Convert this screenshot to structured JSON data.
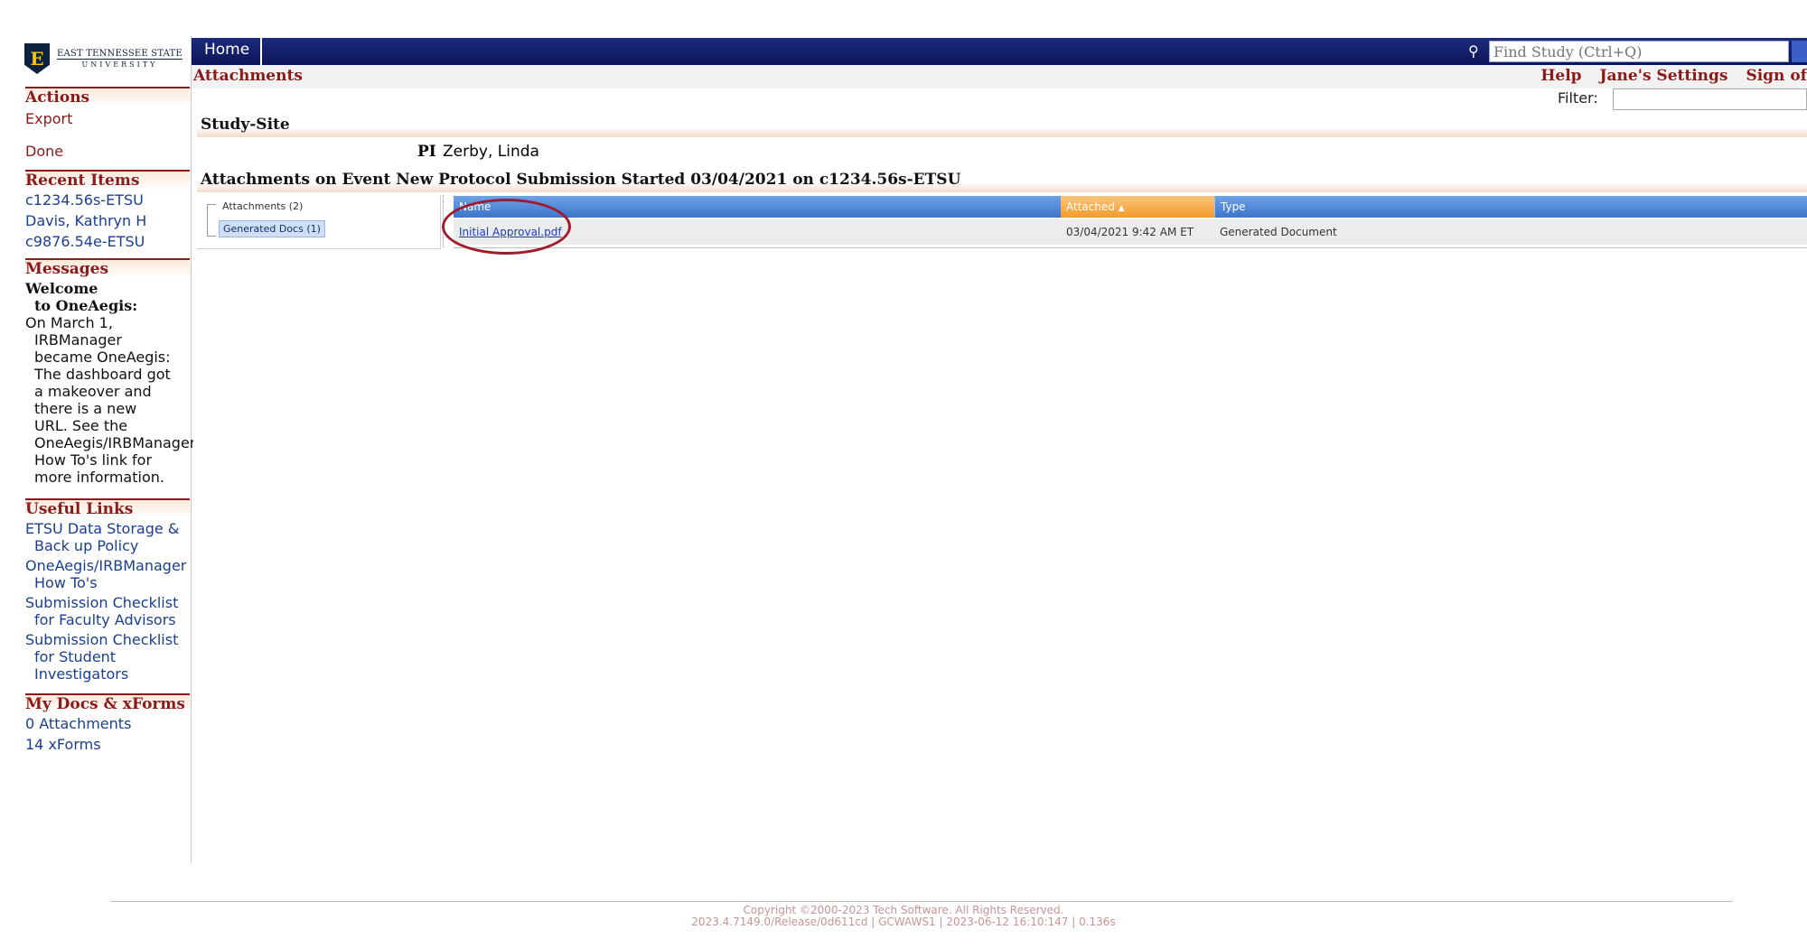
{
  "logo": {
    "letter": "E",
    "line1": "EAST TENNESSEE STATE",
    "line2": "UNIVERSITY"
  },
  "sidebar": {
    "actions": {
      "heading": "Actions",
      "items": [
        "Export",
        "Done"
      ]
    },
    "recent": {
      "heading": "Recent Items",
      "items": [
        "c1234.56s-ETSU",
        "Davis, Kathryn H",
        "c9876.54e-ETSU"
      ]
    },
    "messages": {
      "heading": "Messages",
      "title1": "Welcome",
      "title2": "to OneAegis:",
      "lines": [
        "On March 1,",
        "IRBManager",
        "became OneAegis:",
        " The dashboard got",
        "a makeover and",
        "there is a new",
        "URL.  See the",
        "OneAegis/IRBManager",
        "How To's link for",
        "more information."
      ]
    },
    "useful": {
      "heading": "Useful Links",
      "items": [
        {
          "line1": "ETSU Data Storage &",
          "line2": "Back up Policy"
        },
        {
          "line1": "OneAegis/IRBManager",
          "line2": "How To's"
        },
        {
          "line1": "Submission Checklist",
          "line2": "for Faculty Advisors"
        },
        {
          "line1": "Submission Checklist",
          "line2": "for Student",
          "line3": "Investigators"
        }
      ]
    },
    "mydocs": {
      "heading": "My Docs & xForms",
      "items": [
        "0 Attachments",
        "14 xForms"
      ]
    }
  },
  "topbar": {
    "home": "Home",
    "find_placeholder": "Find Study (Ctrl+Q)",
    "find_icon": "binoculars-icon"
  },
  "subheader": {
    "title": "Attachments",
    "links": [
      "Help",
      "Jane's Settings",
      "Sign of"
    ]
  },
  "filter": {
    "label": "Filter:"
  },
  "study_site": {
    "heading": "Study-Site",
    "pi_label": "PI",
    "pi_value": "Zerby, Linda"
  },
  "attachments_section": {
    "heading": "Attachments on Event New Protocol Submission Started 03/04/2021 on c1234.56s-ETSU"
  },
  "tree": {
    "root": "Attachments (2)",
    "child": "Generated Docs (1)"
  },
  "grid": {
    "columns": [
      "Name",
      "Attached",
      "Type"
    ],
    "sort_indicator": "▲",
    "rows": [
      {
        "name": "Initial Approval.pdf",
        "attached": "03/04/2021 9:42 AM ET",
        "type": "Generated Document"
      }
    ]
  },
  "footer": {
    "copyright": "Copyright ©2000-2023 Tech Software. All Rights Reserved.",
    "build": "2023.4.7149.0/Release/0d611cd | GCWAWS1 | 2023-06-12 16:10:147 | 0.136s"
  },
  "colors": {
    "nav": "#0c1559",
    "accent": "#8b1a1a",
    "link": "#1b3f8f",
    "highlight_circle": "#a01c2c"
  }
}
